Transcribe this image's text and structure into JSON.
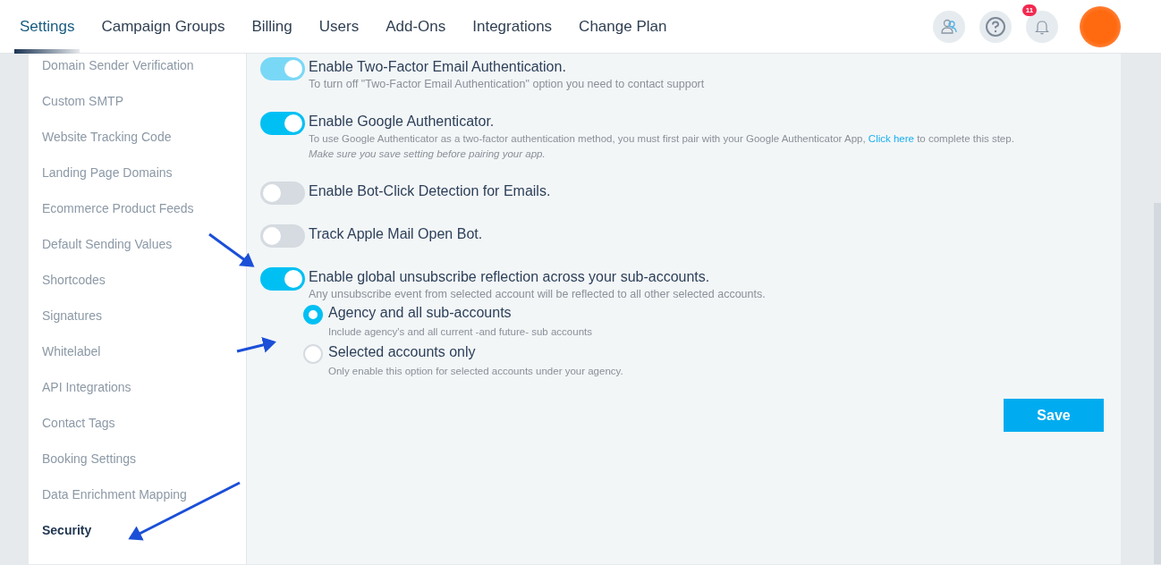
{
  "nav": {
    "tabs": [
      {
        "label": "Settings",
        "selected": true
      },
      {
        "label": "Campaign Groups",
        "selected": false
      },
      {
        "label": "Billing",
        "selected": false
      },
      {
        "label": "Users",
        "selected": false
      },
      {
        "label": "Add-Ons",
        "selected": false
      },
      {
        "label": "Integrations",
        "selected": false
      },
      {
        "label": "Change Plan",
        "selected": false
      }
    ],
    "notifications_badge": "11"
  },
  "sidebar": {
    "items": [
      {
        "label": "Domain Sender Verification",
        "selected": false
      },
      {
        "label": "Custom SMTP",
        "selected": false
      },
      {
        "label": "Website Tracking Code",
        "selected": false
      },
      {
        "label": "Landing Page Domains",
        "selected": false
      },
      {
        "label": "Ecommerce Product Feeds",
        "selected": false
      },
      {
        "label": "Default Sending Values",
        "selected": false
      },
      {
        "label": "Shortcodes",
        "selected": false
      },
      {
        "label": "Signatures",
        "selected": false
      },
      {
        "label": "Whitelabel",
        "selected": false
      },
      {
        "label": "API Integrations",
        "selected": false
      },
      {
        "label": "Contact Tags",
        "selected": false
      },
      {
        "label": "Booking Settings",
        "selected": false
      },
      {
        "label": "Data Enrichment Mapping",
        "selected": false
      },
      {
        "label": "Security",
        "selected": true
      }
    ]
  },
  "settings": [
    {
      "title": "Enable Two-Factor Email Authentication.",
      "on": true,
      "disabled": true,
      "notes": [
        "To turn off \"Two-Factor Email Authentication\" option you need to contact support"
      ]
    },
    {
      "title": "Enable Google Authenticator.",
      "on": true,
      "description": {
        "before": "To use Google Authenticator as a two-factor authentication method, you must first pair with your Google Authenticator App,",
        "link": "Click here",
        "after": "to complete this step."
      },
      "hint": "Make sure you save setting before pairing your app."
    },
    {
      "title": "Enable Bot-Click Detection for Emails.",
      "on": false
    },
    {
      "title": "Track Apple Mail Open Bot.",
      "on": false
    },
    {
      "title": "Enable global unsubscribe reflection across your sub-accounts.",
      "on": true,
      "notes": [
        "Any unsubscribe event from selected account will be reflected to all other selected accounts."
      ],
      "options": [
        {
          "label": "Agency and all sub-accounts",
          "selected": true,
          "description": "Include agency's and all current -and future- sub accounts"
        },
        {
          "label": "Selected accounts only",
          "selected": false,
          "description": "Only enable this option for selected accounts under your agency."
        }
      ]
    }
  ],
  "save_button": "Save"
}
